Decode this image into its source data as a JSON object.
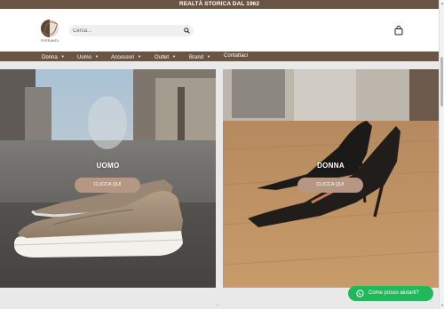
{
  "topbar": {
    "text": "REALTÀ STORICA DAL 1962"
  },
  "header": {
    "logo_text": "FERRANDI",
    "search": {
      "placeholder": "Cerca..."
    }
  },
  "nav": {
    "items": [
      {
        "label": "Donna",
        "has_dropdown": true
      },
      {
        "label": "Uomo",
        "has_dropdown": true
      },
      {
        "label": "Accessori",
        "has_dropdown": true
      },
      {
        "label": "Outlet",
        "has_dropdown": true
      },
      {
        "label": "Brand",
        "has_dropdown": true
      },
      {
        "label": "Contattaci",
        "has_dropdown": false
      }
    ]
  },
  "panels": [
    {
      "title": "UOMO",
      "button": "CLICCA QUI"
    },
    {
      "title": "DONNA",
      "button": "CLICCA QUI"
    }
  ],
  "whatsapp": {
    "label": "Come posso aiutarti?"
  },
  "colors": {
    "brand": "#6a5444",
    "button": "#b59783",
    "whatsapp": "#1fb85a"
  }
}
